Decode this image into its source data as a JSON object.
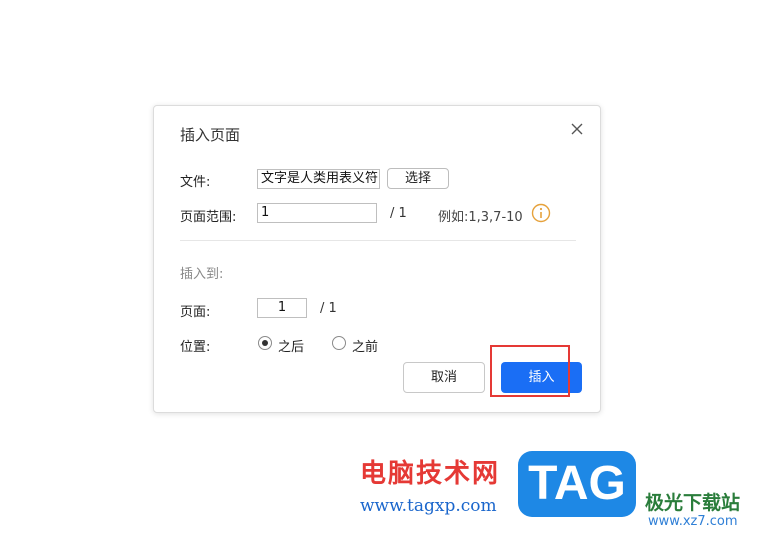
{
  "dialog": {
    "title": "插入页面",
    "file_label": "文件:",
    "file_value": "文字是人类用表义符",
    "select_button": "选择",
    "range_label": "页面范围:",
    "range_value": "1",
    "range_total": "/ 1",
    "example_text": "例如:1,3,7-10",
    "insert_to_label": "插入到:",
    "page_label": "页面:",
    "page_value": "1",
    "page_total": "/ 1",
    "position_label": "位置:",
    "position_after": "之后",
    "position_before": "之前",
    "position_selected": "之后",
    "cancel_button": "取消",
    "insert_button": "插入"
  },
  "icons": {
    "close": "close-icon",
    "info": "info-icon"
  },
  "colors": {
    "primary": "#1a6ef5",
    "highlight": "#e53935",
    "info": "#e6a23c"
  },
  "watermark": {
    "cn": "电脑技术网",
    "url": "www.tagxp.com",
    "tag": "TAG",
    "site_cn": "极光下载站",
    "site_url": "www.xz7.com"
  }
}
